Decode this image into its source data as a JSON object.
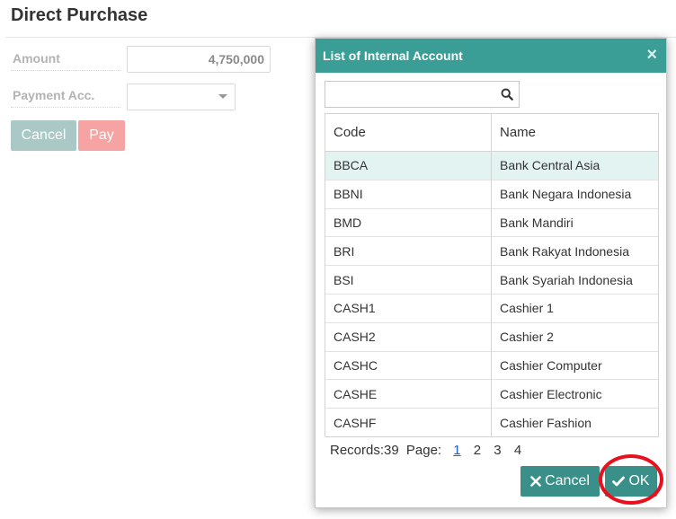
{
  "page": {
    "title": "Direct Purchase"
  },
  "form": {
    "amount_label": "Amount",
    "amount_value": "4,750,000",
    "payment_label": "Payment Acc.",
    "payment_value": "",
    "cancel_label": "Cancel",
    "pay_label": "Pay"
  },
  "dialog": {
    "title": "List of Internal Account",
    "close_glyph": "×",
    "search_placeholder": "",
    "columns": [
      "Code",
      "Name"
    ],
    "rows": [
      {
        "code": "BBCA",
        "name": "Bank Central Asia",
        "selected": true
      },
      {
        "code": "BBNI",
        "name": "Bank Negara Indonesia"
      },
      {
        "code": "BMD",
        "name": "Bank Mandiri"
      },
      {
        "code": "BRI",
        "name": "Bank Rakyat Indonesia"
      },
      {
        "code": "BSI",
        "name": "Bank Syariah Indonesia"
      },
      {
        "code": "CASH1",
        "name": "Cashier 1"
      },
      {
        "code": "CASH2",
        "name": "Cashier 2"
      },
      {
        "code": "CASHC",
        "name": "Cashier Computer"
      },
      {
        "code": "CASHE",
        "name": "Cashier Electronic"
      },
      {
        "code": "CASHF",
        "name": "Cashier Fashion"
      }
    ],
    "pager": {
      "records_label": "Records:39",
      "page_label": "Page:",
      "pages": [
        "1",
        "2",
        "3",
        "4"
      ],
      "current_page": "1"
    },
    "cancel_label": "Cancel",
    "ok_label": "OK"
  },
  "icons": {
    "search": "search-icon",
    "close": "close-icon",
    "cancel": "times-icon",
    "ok": "check-icon",
    "dropdown": "caret-down-icon"
  },
  "colors": {
    "header_teal": "#3a9e97",
    "button_teal": "#3a8f88",
    "selected_row": "#e3f3f2",
    "cancel_disabled": "#a9c8c6",
    "pay_disabled": "#f5a3a3",
    "highlight_ring": "#e8101c",
    "page_link": "#1a5fd0"
  }
}
